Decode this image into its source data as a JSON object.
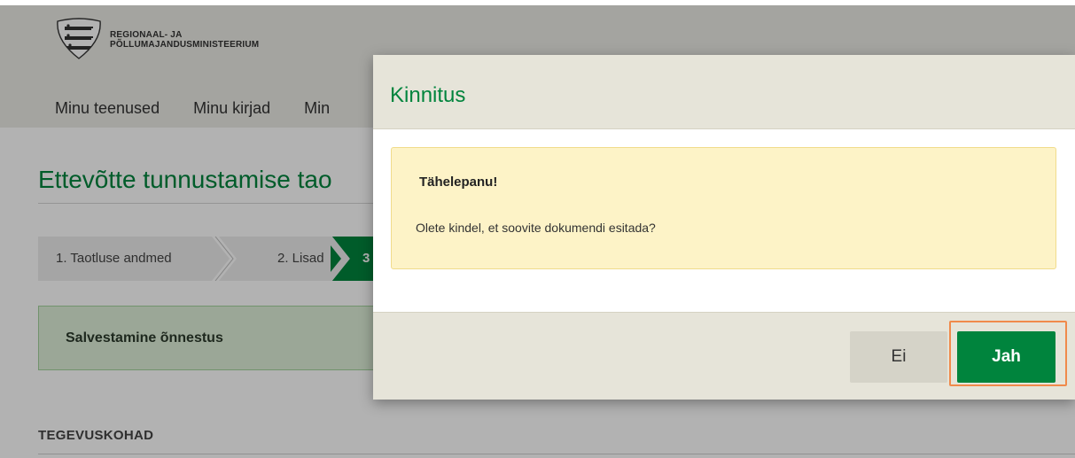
{
  "header": {
    "logo_line1": "REGIONAAL- JA",
    "logo_line2": "PÕLLUMAJANDUSMINISTEERIUM",
    "nav": [
      "Minu teenused",
      "Minu kirjad",
      "Min"
    ]
  },
  "page": {
    "title": "Ettevõtte tunnustamise tao",
    "steps": [
      "1. Taotluse andmed",
      "2. Lisad",
      "3"
    ],
    "success_message": "Salvestamine õnnestus",
    "section_label": "TEGEVUSKOHAD"
  },
  "modal": {
    "title": "Kinnitus",
    "warning_title": "Tähelepanu!",
    "warning_text": "Olete kindel, et soovite dokumendi esitada?",
    "no_label": "Ei",
    "yes_label": "Jah"
  },
  "colors": {
    "brand_green": "#00843d",
    "highlight": "#f08a4b",
    "warning_bg": "#fdf3c7",
    "success_bg": "#dff0d8"
  }
}
